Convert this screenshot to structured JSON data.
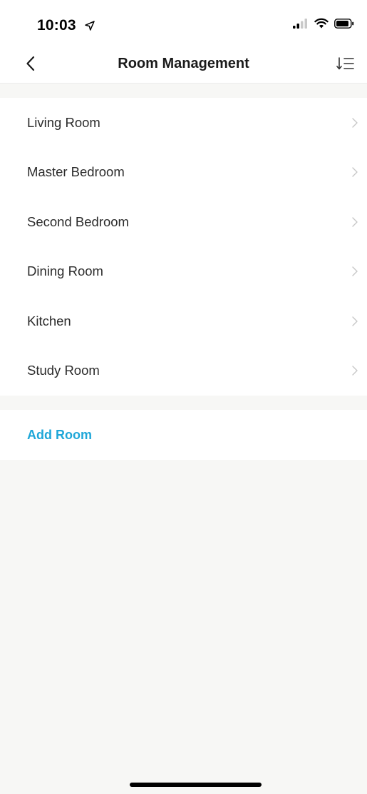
{
  "status_bar": {
    "time": "10:03",
    "icons": [
      "location-arrow-icon",
      "cellular-signal-icon",
      "wifi-icon",
      "battery-icon"
    ]
  },
  "nav": {
    "title": "Room Management",
    "back_icon": "chevron-left-icon",
    "sort_icon": "sort-list-icon"
  },
  "rooms": [
    {
      "label": "Living Room"
    },
    {
      "label": "Master Bedroom"
    },
    {
      "label": "Second Bedroom"
    },
    {
      "label": "Dining Room"
    },
    {
      "label": "Kitchen"
    },
    {
      "label": "Study Room"
    }
  ],
  "add_room": {
    "label": "Add Room"
  },
  "colors": {
    "accent": "#1fa7d8",
    "background": "#f7f7f5",
    "surface": "#ffffff",
    "text": "#2b2b2b"
  }
}
